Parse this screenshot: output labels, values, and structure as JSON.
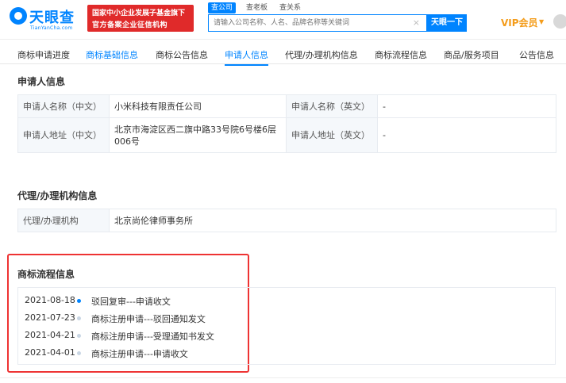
{
  "header": {
    "logo_text": "天眼查",
    "logo_sub": "TianYanCha.com",
    "banner_line1": "国家中小企业发展子基金旗下",
    "banner_line2": "官方备案企业征信机构",
    "search_tabs": [
      "查公司",
      "查老板",
      "查关系"
    ],
    "search_placeholder": "请输入公司名称、人名、品牌名称等关键词",
    "search_clear": "×",
    "search_button": "天眼一下",
    "vip_label": "VIP会员",
    "vip_caret": "▼"
  },
  "tabs": [
    "商标申请进度",
    "商标基础信息",
    "商标公告信息",
    "申请人信息",
    "代理/办理机构信息",
    "商标流程信息",
    "商品/服务项目",
    "公告信息"
  ],
  "applicant": {
    "title": "申请人信息",
    "name_cn_label": "申请人名称（中文）",
    "name_cn_value": "小米科技有限责任公司",
    "name_en_label": "申请人名称（英文）",
    "name_en_value": "-",
    "addr_cn_label": "申请人地址（中文）",
    "addr_cn_value": "北京市海淀区西二旗中路33号院6号楼6层006号",
    "addr_en_label": "申请人地址（英文）",
    "addr_en_value": "-"
  },
  "agent": {
    "title": "代理/办理机构信息",
    "label": "代理/办理机构",
    "value": "北京尚伦律师事务所"
  },
  "flow": {
    "title": "商标流程信息",
    "items": [
      {
        "date": "2021-08-18",
        "text": "驳回复审---申请收文"
      },
      {
        "date": "2021-07-23",
        "text": "商标注册申请---驳回通知发文"
      },
      {
        "date": "2021-04-21",
        "text": "商标注册申请---受理通知书发文"
      },
      {
        "date": "2021-04-01",
        "text": "商标注册申请---申请收文"
      }
    ]
  },
  "colors": {
    "brand": "#0084ff",
    "banner": "#e02a2a",
    "vip": "#f49c1a",
    "highlight_frame": "#ee3333"
  }
}
